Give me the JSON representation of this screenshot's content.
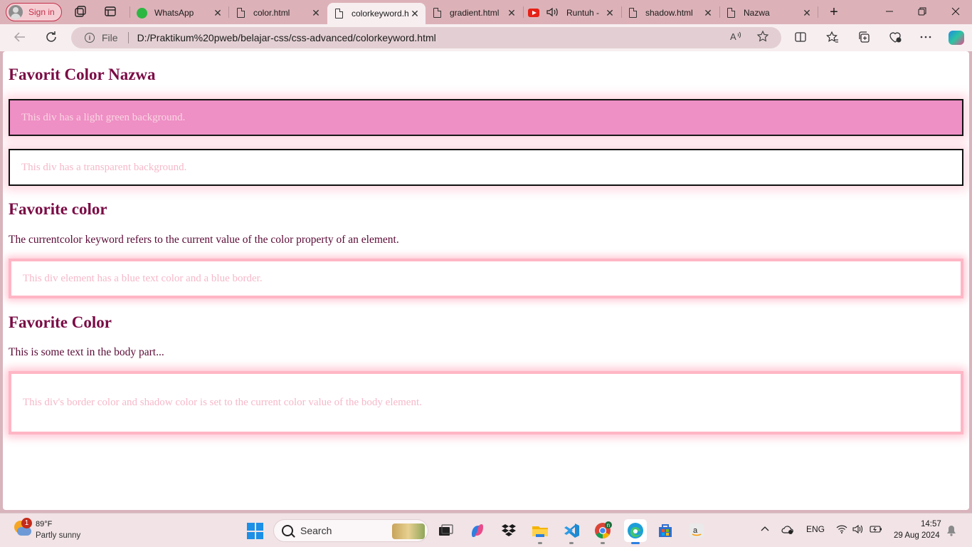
{
  "browser": {
    "signin_label": "Sign in",
    "tabs": [
      {
        "title": "WhatsApp",
        "icon": "whatsapp-icon"
      },
      {
        "title": "color.html",
        "icon": "page-icon"
      },
      {
        "title": "colorkeyword.h",
        "icon": "page-icon",
        "active": true
      },
      {
        "title": "gradient.html",
        "icon": "page-icon"
      },
      {
        "title": "Runtuh -",
        "icon": "youtube-icon",
        "audio": true
      },
      {
        "title": "shadow.html",
        "icon": "page-icon"
      },
      {
        "title": "Nazwa",
        "icon": "page-icon"
      }
    ],
    "new_tab_glyph": "+",
    "address": {
      "scheme_label": "File",
      "url": "D:/Praktikum%20pweb/belajar-css/css-advanced/colorkeyword.html"
    }
  },
  "page": {
    "heading1": "Favorit Color Nazwa",
    "box1": "This div has a light green background.",
    "box2": "This div has a transparent background.",
    "heading2": "Favorite color",
    "paragraph1": "The currentcolor keyword refers to the current value of the color property of an element.",
    "box3": "This div element has a blue text color and a blue border.",
    "heading3": "Favorite Color",
    "paragraph2": "This is some text in the body part...",
    "box4": "This div's border color and shadow color is set to the current color value of the body element."
  },
  "taskbar": {
    "weather": {
      "temp": "89°F",
      "desc": "Partly sunny",
      "badge": "1"
    },
    "search_placeholder": "Search",
    "tray": {
      "lang": "ENG"
    },
    "clock": {
      "time": "14:57",
      "date": "29 Aug 2024"
    }
  },
  "colors": {
    "tabstrip": "#dcb2b8",
    "heading": "#7a0b45",
    "box1_bg": "#ee8fc5",
    "box_border_pink": "#ffb6c5",
    "box_text": "#f6b8c9"
  }
}
